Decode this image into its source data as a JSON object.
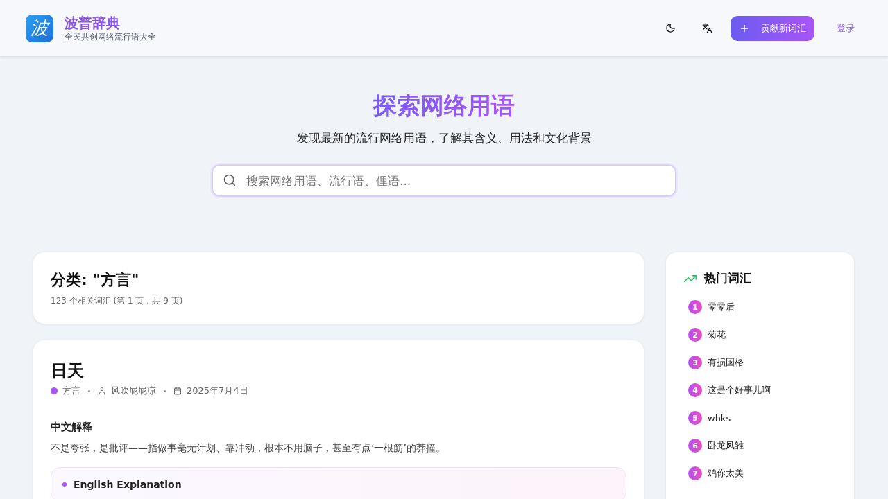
{
  "header": {
    "logo_char": "波",
    "title": "波普辞典",
    "subtitle": "全民共创网络流行语大全",
    "contribute_button": "贡献新词汇",
    "login_link": "登录"
  },
  "hero": {
    "title": "探索网络用语",
    "subtitle": "发现最新的流行网络用语，了解其含义、用法和文化背景",
    "search": {
      "placeholder": "搜索网络用语、流行语、俚语..."
    }
  },
  "category": {
    "title": "分类: \"方言\"",
    "summary": "123 个相关词汇 (第 1 页，共 9 页)"
  },
  "entry": {
    "word": "日天",
    "category": "方言",
    "color": "#a855f7",
    "author": "风吹屁屁凉",
    "date": "2025年7月4日",
    "chinese_heading": "中文解释",
    "chinese_text": "不是夸张，是批评——指做事毫无计划、靠冲动，根本不用脑子，甚至有点‘一根筋’的莽撞。",
    "english_heading": "English Explanation"
  },
  "trending": {
    "title": "热门词汇",
    "items": [
      {
        "rank": "1",
        "word": "零零后"
      },
      {
        "rank": "2",
        "word": "菊花"
      },
      {
        "rank": "3",
        "word": "有损国格"
      },
      {
        "rank": "4",
        "word": "这是个好事儿啊"
      },
      {
        "rank": "5",
        "word": "whks"
      },
      {
        "rank": "6",
        "word": "卧龙凤雏"
      },
      {
        "rank": "7",
        "word": "鸡你太美"
      }
    ]
  }
}
